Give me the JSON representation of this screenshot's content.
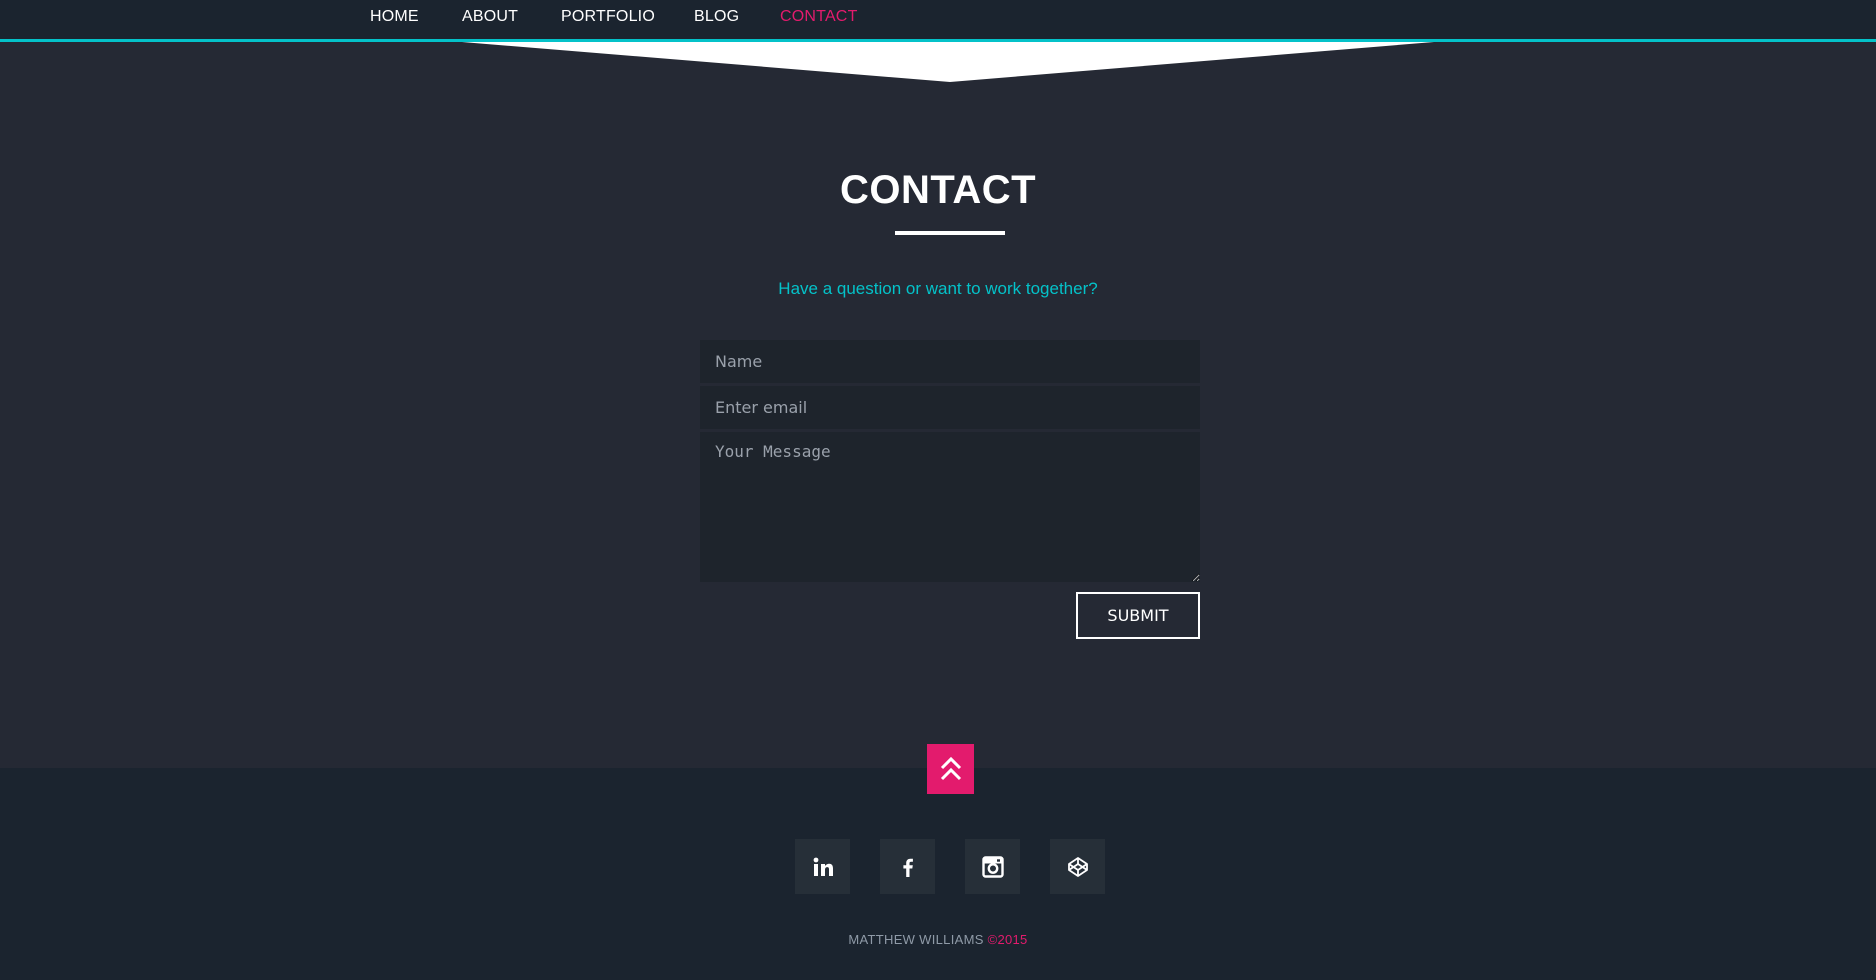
{
  "nav": {
    "items": [
      {
        "label": "HOME"
      },
      {
        "label": "ABOUT"
      },
      {
        "label": "PORTFOLIO"
      },
      {
        "label": "BLOG"
      },
      {
        "label": "CONTACT",
        "active": true
      }
    ]
  },
  "contact": {
    "title": "CONTACT",
    "subtitle": "Have a question or want to work together?",
    "name_placeholder": "Name",
    "email_placeholder": "Enter email",
    "message_placeholder": "Your Message",
    "submit_label": "SUBMIT"
  },
  "footer": {
    "back_to_top_icon": "double-chevron-up-icon",
    "social": [
      {
        "icon": "linkedin-icon"
      },
      {
        "icon": "facebook-icon"
      },
      {
        "icon": "instagram-icon"
      },
      {
        "icon": "codepen-icon"
      }
    ],
    "credit_name": "MATTHEW WILLIAMS ",
    "credit_year": "©2015"
  },
  "colors": {
    "accent_pink": "#e31b6d",
    "accent_teal": "#04c2c9",
    "background": "#252934",
    "nav_background": "#1b242f"
  }
}
